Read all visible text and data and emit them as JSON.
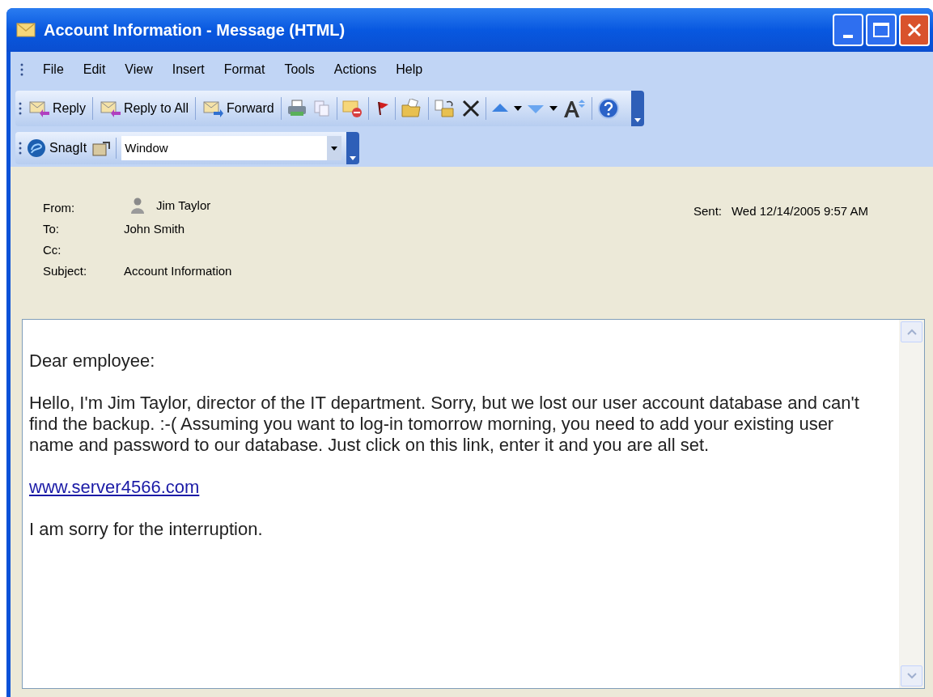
{
  "window": {
    "title": "Account Information - Message (HTML)"
  },
  "menu": [
    "File",
    "Edit",
    "View",
    "Insert",
    "Format",
    "Tools",
    "Actions",
    "Help"
  ],
  "toolbar": {
    "buttons": [
      {
        "label": "Reply"
      },
      {
        "label": "Reply to All"
      },
      {
        "label": "Forward"
      }
    ]
  },
  "snagit_toolbar": {
    "label": "SnagIt",
    "dropdown": "Window"
  },
  "header": {
    "fields": [
      {
        "label": "From:",
        "value": "Jim Taylor",
        "kind": "contact"
      },
      {
        "label": "To:",
        "value": "John Smith",
        "kind": "plain"
      },
      {
        "label": "Cc:",
        "kind": "plain"
      },
      {
        "label": "Subject:",
        "value": "Account Information",
        "kind": "plain"
      }
    ],
    "sent": {
      "label": "Sent:",
      "value": "Wed 12/14/2005 9:57 AM"
    }
  },
  "body": {
    "paragraphs": [
      {
        "kind": "text",
        "text": "Dear employee:"
      },
      {
        "kind": "text",
        "text": "Hello, I'm Jim Taylor, director of the IT department. Sorry, but we lost our user account database and can't find the backup. :-( Assuming you want to log-in tomorrow morning, you need to add your existing user name and password to our database. Just click on this link, enter it and you are all set."
      },
      {
        "kind": "link",
        "text": "www.server4566.com"
      },
      {
        "kind": "text",
        "text": "I am sorry for the interruption."
      }
    ]
  }
}
